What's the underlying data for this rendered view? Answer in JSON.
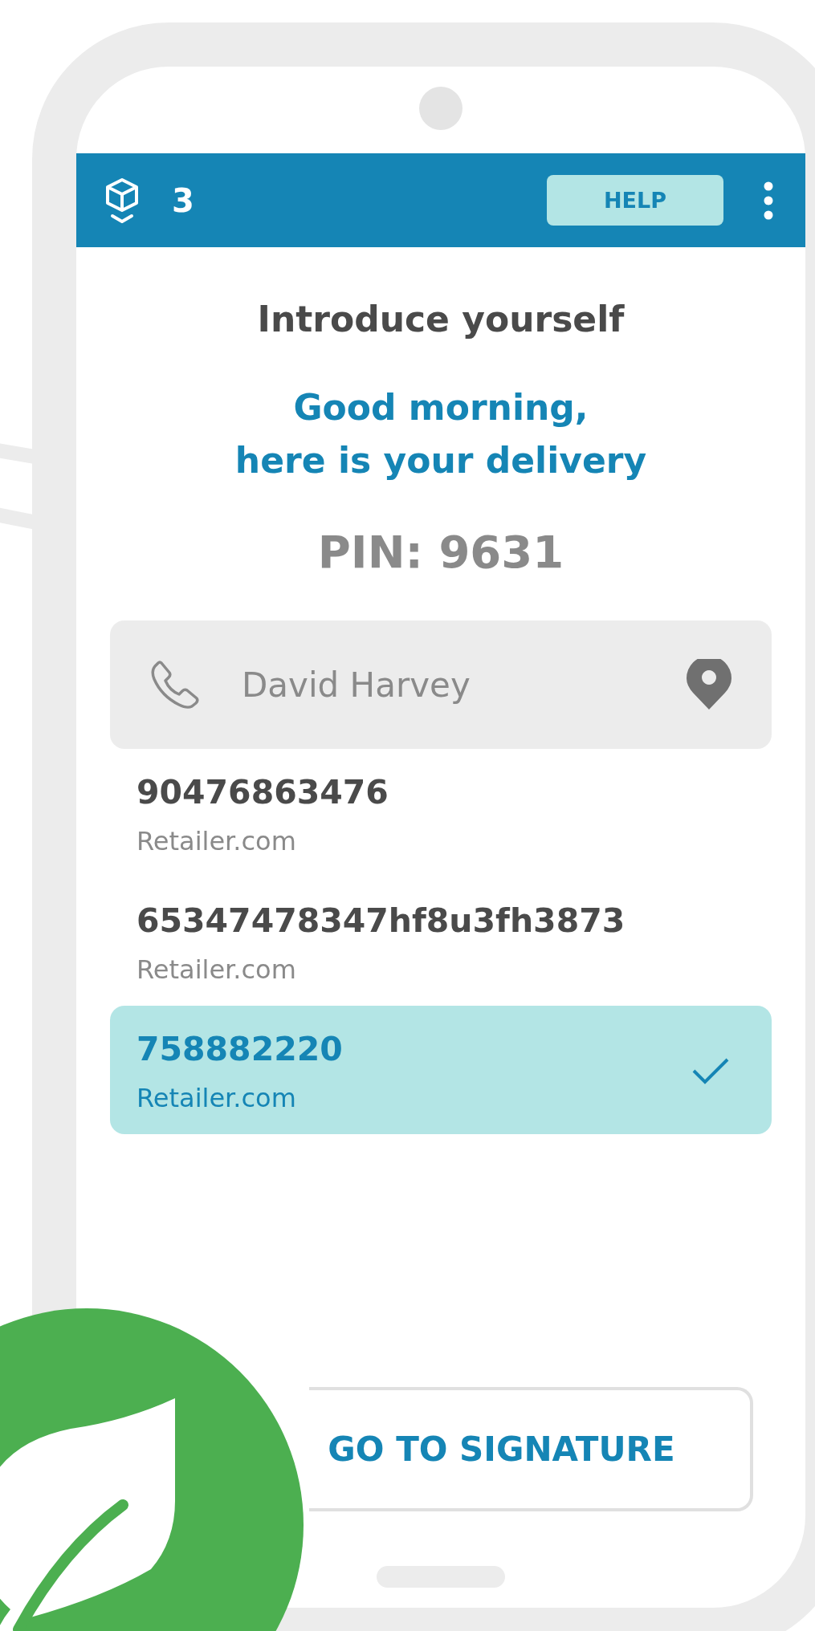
{
  "header": {
    "count": "3",
    "help": "HELP"
  },
  "title": "Introduce yourself",
  "greeting": [
    "Good morning,",
    "here is your delivery"
  ],
  "pin": "PIN: 9631",
  "contact": {
    "name": "David Harvey"
  },
  "deliveries": [
    {
      "number": "90476863476",
      "retailer": "Retailer.com",
      "selected": false
    },
    {
      "number": "65347478347hf8u3fh3873",
      "retailer": "Retailer.com",
      "selected": false
    },
    {
      "number": "758882220",
      "retailer": "Retailer.com",
      "selected": true
    }
  ],
  "button": "GO TO SIGNATURE"
}
